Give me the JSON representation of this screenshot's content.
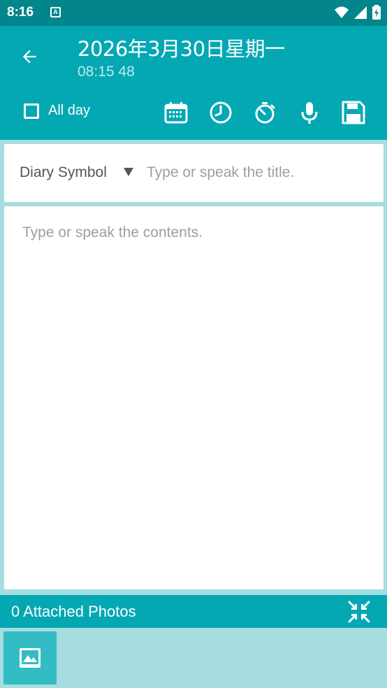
{
  "status_bar": {
    "time": "8:16",
    "notification_badge": "A",
    "icons": [
      "wifi-icon",
      "signal-icon",
      "battery-charging-icon"
    ]
  },
  "header": {
    "date": "2026年3月30日星期一",
    "time": "08:15 48",
    "back_icon": "arrow-left-icon"
  },
  "toolbar": {
    "all_day_label": "All day",
    "all_day_checked": false,
    "icons": [
      "calendar-icon",
      "clock-icon",
      "stopwatch-icon",
      "microphone-icon",
      "save-icon"
    ]
  },
  "title_row": {
    "symbol_label": "Diary Symbol",
    "title_placeholder": "Type or speak the title."
  },
  "content": {
    "placeholder": "Type or speak the contents."
  },
  "photos": {
    "label": "0 Attached Photos",
    "collapse_icon": "collapse-icon",
    "add_icon": "image-icon"
  },
  "colors": {
    "status_bar": "#03858c",
    "primary": "#03a8b3",
    "background": "#a5dde0",
    "photo_button": "#34bcc5"
  }
}
